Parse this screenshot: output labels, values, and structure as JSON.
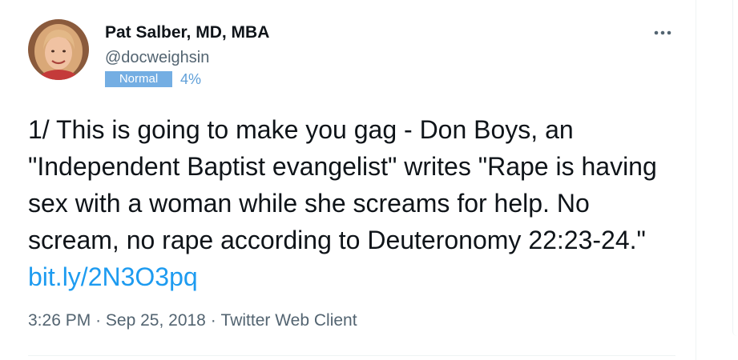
{
  "author": {
    "name": "Pat Salber, MD, MBA",
    "handle": "@docweighsin",
    "badge_label": "Normal",
    "badge_percent": "4%"
  },
  "tweet": {
    "text": "1/ This is going to make you gag - Don Boys, an \"Independent Baptist evangelist\" writes \"Rape is having sex with a woman while she screams for help. No scream, no rape according to Deuteronomy 22:23-24.\" ",
    "link": "bit.ly/2N3O3pq",
    "time": "3:26 PM",
    "separator": "·",
    "date": "Sep 25, 2018",
    "source": "Twitter Web Client"
  },
  "icons": {
    "more": "more-options-icon",
    "avatar": "profile-photo"
  },
  "colors": {
    "link": "#1d9bf0",
    "badge": "#74aee3",
    "secondary_text": "#536471"
  }
}
